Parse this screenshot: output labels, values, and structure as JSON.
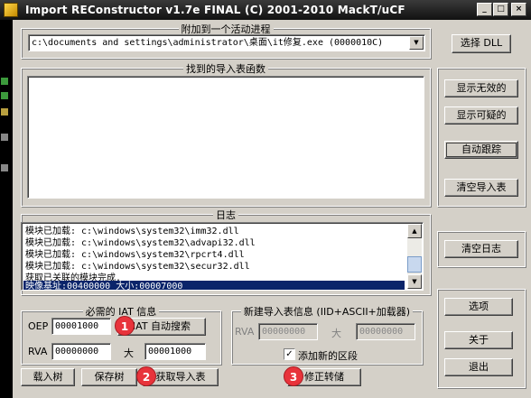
{
  "window": {
    "title": "Import REConstructor v1.7e FINAL (C) 2001-2010 MackT/uCF",
    "controls": {
      "minimize": "_",
      "maximize": "□",
      "close": "×"
    }
  },
  "attach": {
    "group_title": "附加到一个活动进程",
    "process_value": "c:\\documents and settings\\administrator\\桌面\\it修复.exe (0000010C)",
    "select_dll_label": "选择 DLL"
  },
  "imports": {
    "group_title": "找到的导入表函数"
  },
  "right_buttons": {
    "show_invalid": "显示无效的",
    "show_suspect": "显示可疑的",
    "auto_trace": "自动跟踪",
    "clear_imports": "清空导入表",
    "clear_log": "清空日志",
    "options": "选项",
    "about": "关于",
    "exit": "退出"
  },
  "log": {
    "group_title": "日志",
    "lines": [
      "模块已加载: c:\\windows\\system32\\imm32.dll",
      "模块已加载: c:\\windows\\system32\\advapi32.dll",
      "模块已加载: c:\\windows\\system32\\rpcrt4.dll",
      "模块已加载: c:\\windows\\system32\\secur32.dll",
      "获取已关联的模块完成.",
      "映像基址:00400000 大小:00007000"
    ]
  },
  "iat_info": {
    "group_title": "必需的 IAT 信息",
    "oep_label": "OEP",
    "oep_value": "00001000",
    "iat_autosearch_label": "IAT 自动搜索",
    "rva_label": "RVA",
    "rva_value": "00000000",
    "size_label": "大",
    "size_value": "00001000"
  },
  "new_iat": {
    "group_title": "新建导入表信息 (IID+ASCII+加载器)",
    "rva_label": "RVA",
    "rva_value": "00000000",
    "size_label": "大",
    "size_value": "00000000",
    "add_section_label": "添加新的区段",
    "add_section_checked": "✓"
  },
  "bottom_buttons": {
    "load_tree": "载入树",
    "save_tree": "保存树",
    "get_imports": "获取导入表",
    "fix_dump": "修正转储"
  },
  "annotations": {
    "step1": "1",
    "step2": "2",
    "step3": "3"
  },
  "colors": {
    "dialog_bg": "#d4d0c8",
    "selection": "#0a246a",
    "badge": "#e8333b"
  }
}
